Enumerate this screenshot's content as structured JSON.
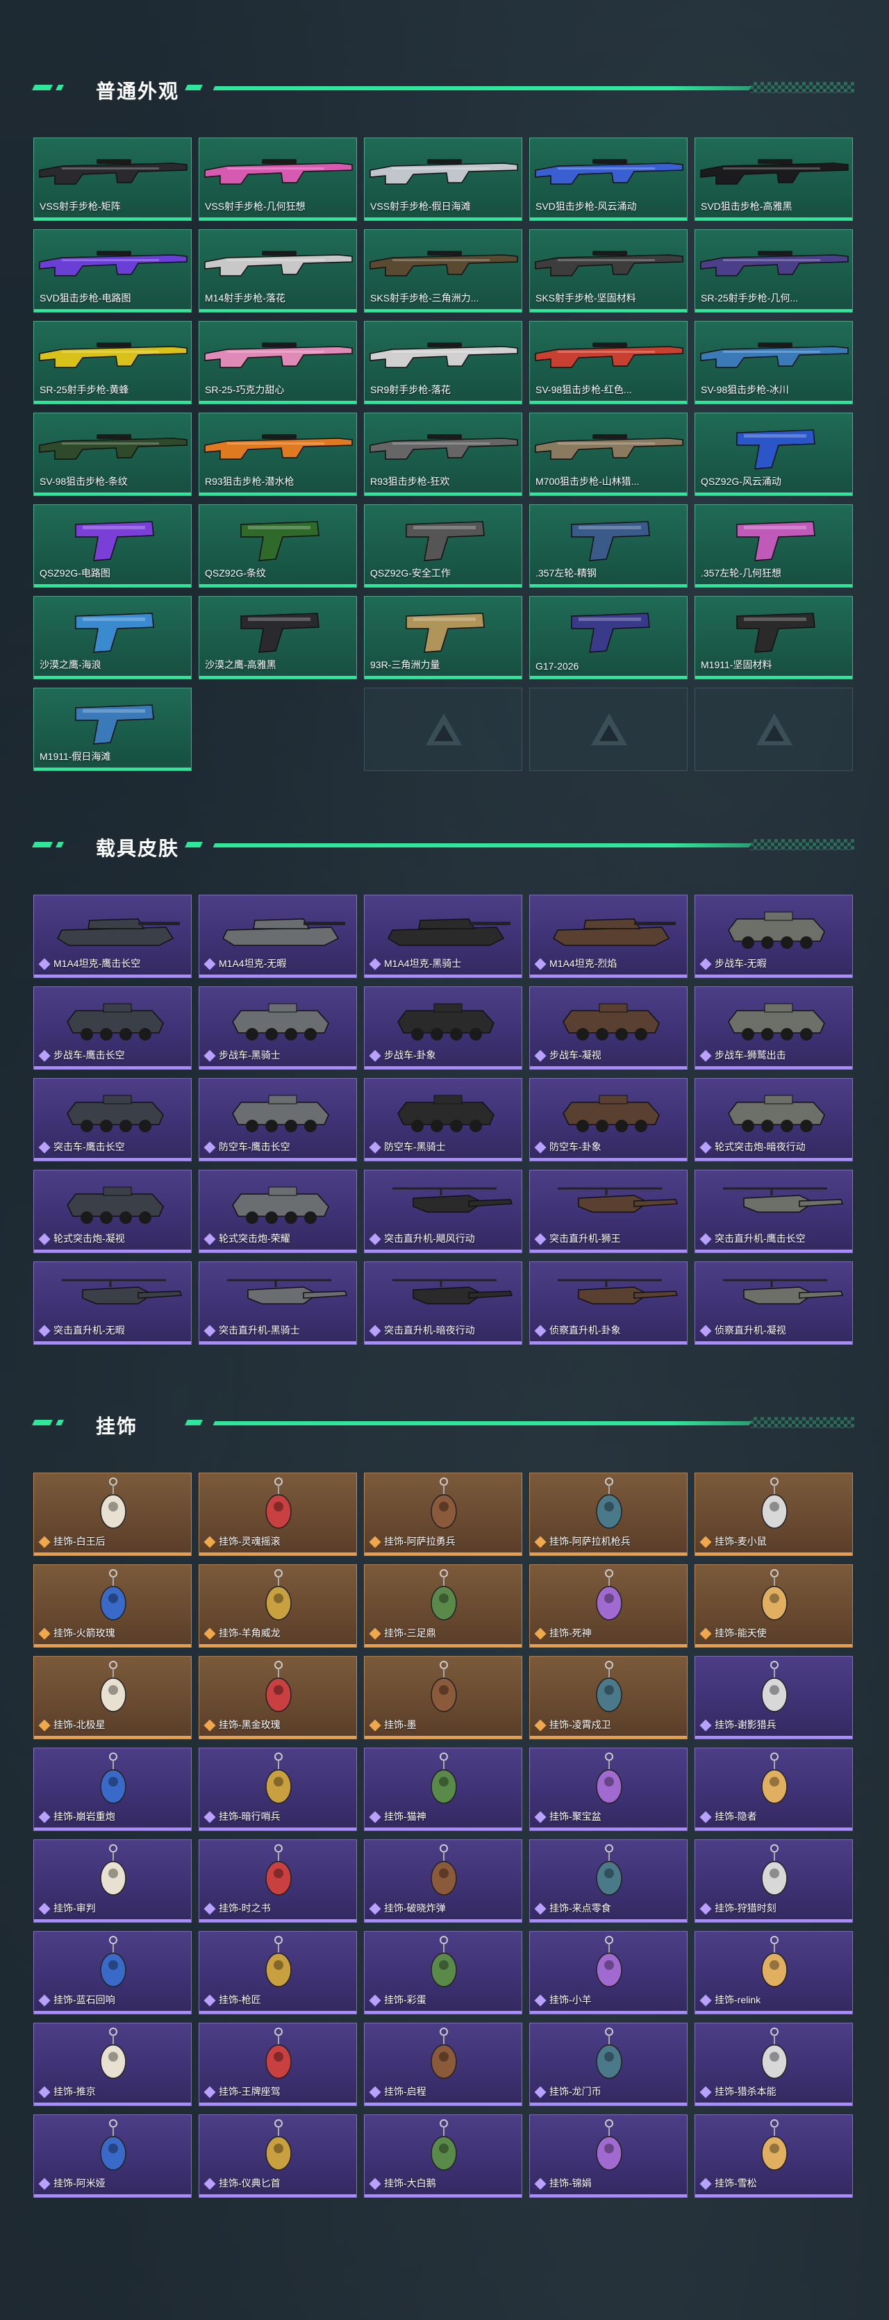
{
  "sections": {
    "weapons": {
      "title": "普通外观",
      "items": [
        "VSS射手步枪-矩阵",
        "VSS射手步枪-几何狂想",
        "VSS射手步枪-假日海滩",
        "SVD狙击步枪-风云涌动",
        "SVD狙击步枪-高雅黑",
        "SVD狙击步枪-电路图",
        "M14射手步枪-落花",
        "SKS射手步枪-三角洲力...",
        "SKS射手步枪-坚固材料",
        "SR-25射手步枪-几何...",
        "SR-25射手步枪-黄蜂",
        "SR-25-巧克力甜心",
        "SR9射手步枪-落花",
        "SV-98狙击步枪-红色...",
        "SV-98狙击步枪-冰川",
        "SV-98狙击步枪-条纹",
        "R93狙击步枪-潜水枪",
        "R93狙击步枪-狂欢",
        "M700狙击步枪-山林猎...",
        "QSZ92G-风云涌动",
        "QSZ92G-电路图",
        "QSZ92G-条纹",
        "QSZ92G-安全工作",
        ".357左轮-精钢",
        ".357左轮-几何狂想",
        "沙漠之鹰-海浪",
        "沙漠之鹰-高雅黑",
        "93R-三角洲力量",
        "G17-2026",
        "M1911-坚固材料",
        "M1911-假日海滩"
      ]
    },
    "vehicles": {
      "title": "载具皮肤",
      "items": [
        "M1A4坦克-鹰击长空",
        "M1A4坦克-无暇",
        "M1A4坦克-黑骑士",
        "M1A4坦克-烈焰",
        "步战车-无暇",
        "步战车-鹰击长空",
        "步战车-黑骑士",
        "步战车-卦象",
        "步战车-凝视",
        "步战车-狮鹫出击",
        "突击车-鹰击长空",
        "防空车-鹰击长空",
        "防空车-黑骑士",
        "防空车-卦象",
        "轮式突击炮-暗夜行动",
        "轮式突击炮-凝视",
        "轮式突击炮-荣耀",
        "突击直升机-飓风行动",
        "突击直升机-狮王",
        "突击直升机-鹰击长空",
        "突击直升机-无暇",
        "突击直升机-黑骑士",
        "突击直升机-暗夜行动",
        "侦察直升机-卦象",
        "侦察直升机-凝视"
      ]
    },
    "charms": {
      "title": "挂饰",
      "items": [
        {
          "label": "挂饰-白王后",
          "tone": "orange"
        },
        {
          "label": "挂饰-灵魂摇滚",
          "tone": "orange"
        },
        {
          "label": "挂饰-阿萨拉勇兵",
          "tone": "orange"
        },
        {
          "label": "挂饰-阿萨拉机枪兵",
          "tone": "orange"
        },
        {
          "label": "挂饰-麦小鼠",
          "tone": "orange"
        },
        {
          "label": "挂饰-火箭玫瑰",
          "tone": "orange"
        },
        {
          "label": "挂饰-羊角威龙",
          "tone": "orange"
        },
        {
          "label": "挂饰-三足鼎",
          "tone": "orange"
        },
        {
          "label": "挂饰-死神",
          "tone": "orange"
        },
        {
          "label": "挂饰-能天使",
          "tone": "orange"
        },
        {
          "label": "挂饰-北极星",
          "tone": "orange"
        },
        {
          "label": "挂饰-黑金玫瑰",
          "tone": "orange"
        },
        {
          "label": "挂饰-墨",
          "tone": "orange"
        },
        {
          "label": "挂饰-凌霄戍卫",
          "tone": "orange"
        },
        {
          "label": "挂饰-谢影猎兵",
          "tone": "purple"
        },
        {
          "label": "挂饰-崩岩重炮",
          "tone": "purple"
        },
        {
          "label": "挂饰-暗行哨兵",
          "tone": "purple"
        },
        {
          "label": "挂饰-猫神",
          "tone": "purple"
        },
        {
          "label": "挂饰-聚宝盆",
          "tone": "purple"
        },
        {
          "label": "挂饰-隐者",
          "tone": "purple"
        },
        {
          "label": "挂饰-审判",
          "tone": "purple"
        },
        {
          "label": "挂饰-时之书",
          "tone": "purple"
        },
        {
          "label": "挂饰-破晓炸弹",
          "tone": "purple"
        },
        {
          "label": "挂饰-来点零食",
          "tone": "purple"
        },
        {
          "label": "挂饰-狩猎时刻",
          "tone": "purple"
        },
        {
          "label": "挂饰-蓝石回响",
          "tone": "purple"
        },
        {
          "label": "挂饰-枪匠",
          "tone": "purple"
        },
        {
          "label": "挂饰-彩蛋",
          "tone": "purple"
        },
        {
          "label": "挂饰-小羊",
          "tone": "purple"
        },
        {
          "label": "挂饰-relink",
          "tone": "purple"
        },
        {
          "label": "挂饰-推京",
          "tone": "purple"
        },
        {
          "label": "挂饰-王牌座驾",
          "tone": "purple"
        },
        {
          "label": "挂饰-启程",
          "tone": "purple"
        },
        {
          "label": "挂饰-龙门币",
          "tone": "purple"
        },
        {
          "label": "挂饰-猎杀本能",
          "tone": "purple"
        },
        {
          "label": "挂饰-阿米娅",
          "tone": "purple"
        },
        {
          "label": "挂饰-仪典匕首",
          "tone": "purple"
        },
        {
          "label": "挂饰-大白鹅",
          "tone": "purple"
        },
        {
          "label": "挂饰-锦娟",
          "tone": "purple"
        },
        {
          "label": "挂饰-雪松",
          "tone": "purple"
        }
      ]
    }
  },
  "colors": {
    "accent": "#2ee89a",
    "weapon_card": "#1f6b55",
    "vehicle_card": "#4c3e86",
    "charm_orange": "#7a5a3a",
    "charm_purple": "#4c3e86"
  }
}
